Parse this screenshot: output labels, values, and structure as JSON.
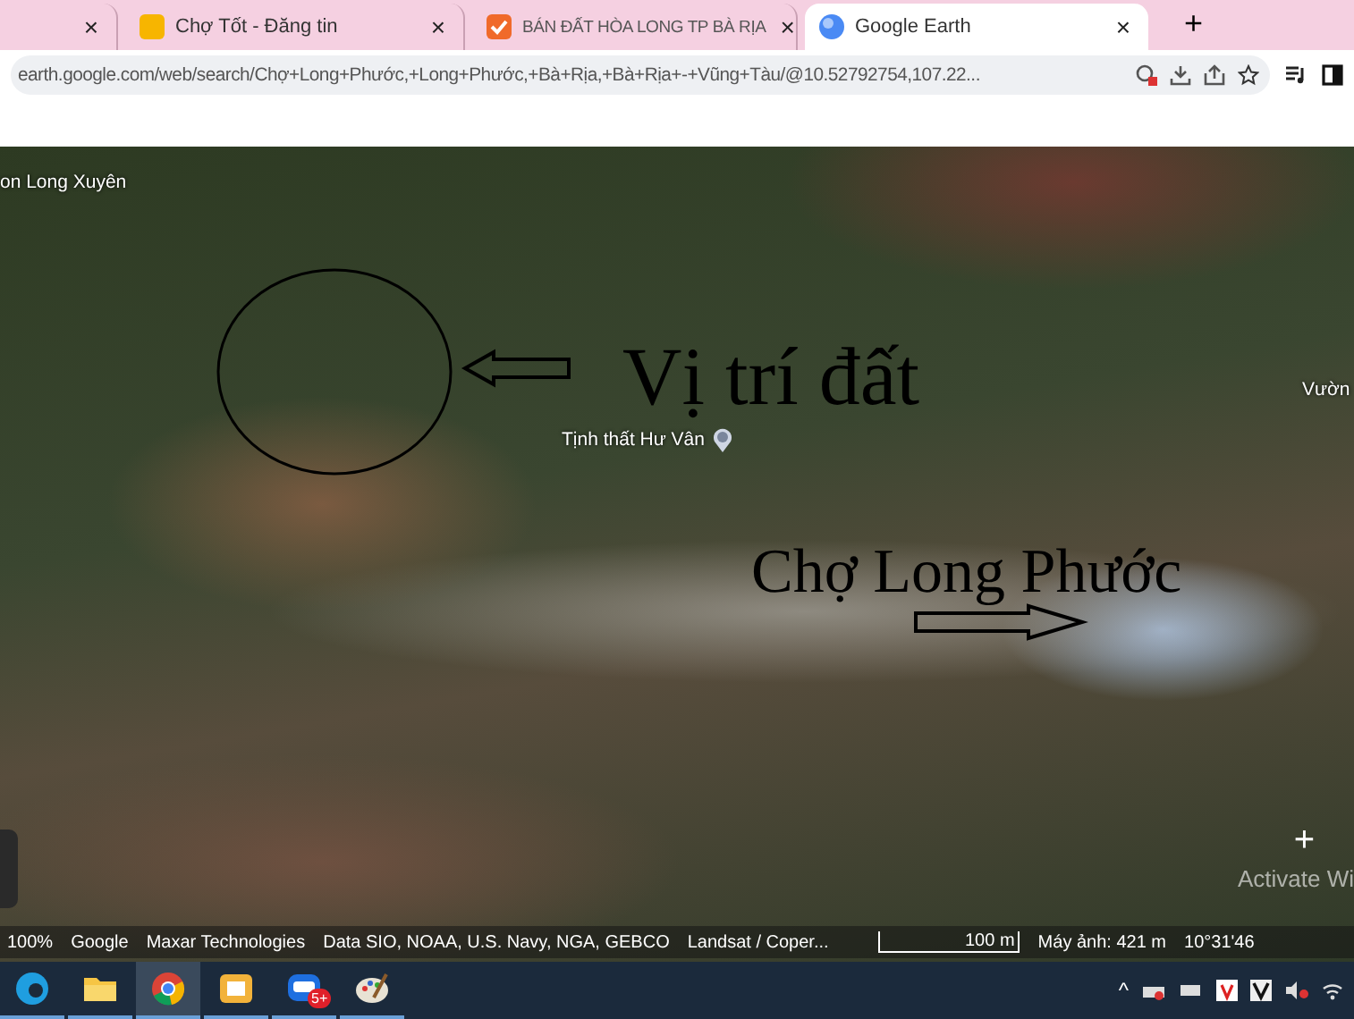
{
  "browser": {
    "tabs": [
      {
        "selected": false,
        "close": "×"
      },
      {
        "title": "Chợ Tốt - Đăng tin",
        "selected": false,
        "close": "×"
      },
      {
        "title": "BÁN ĐẤT HÒA LONG TP BÀ RỊA",
        "selected": false,
        "close": "×"
      },
      {
        "title": "Google Earth",
        "selected": true,
        "close": "×"
      }
    ],
    "new_tab": "+",
    "address": "earth.google.com/web/search/Chợ+Long+Phước,+Long+Phước,+Bà+Rịa,+Bà+Rịa+-+Vũng+Tàu/@10.52792754,107.22..."
  },
  "map": {
    "place_labels": [
      {
        "text": "on Long Xuyên",
        "pin": false
      },
      {
        "text": "Tịnh thất Hư Vân",
        "pin": true
      },
      {
        "text": "Vườn",
        "pin": false
      }
    ],
    "annotations": [
      {
        "kind": "circle"
      },
      {
        "kind": "left-arrow"
      },
      {
        "kind": "text",
        "text": "Vị trí đất"
      },
      {
        "kind": "text",
        "text": "Chợ Long Phước"
      },
      {
        "kind": "right-arrow"
      }
    ],
    "zoom_in": "+",
    "os_notice": "Activate Wi",
    "status": {
      "zoom": "100%",
      "credits": [
        "Google",
        "Maxar Technologies",
        "Data SIO, NOAA, U.S. Navy, NGA, GEBCO",
        "Landsat / Coper..."
      ],
      "scale": "100 m",
      "camera": "Máy ảnh: 421 m",
      "coords": "10°31'46"
    }
  },
  "taskbar": {
    "apps": [
      {
        "selected": false
      },
      {
        "selected": false
      },
      {
        "selected": true
      },
      {
        "selected": false
      },
      {
        "selected": false,
        "badge": "5+"
      },
      {
        "selected": false
      }
    ],
    "tray_caret": "^"
  }
}
